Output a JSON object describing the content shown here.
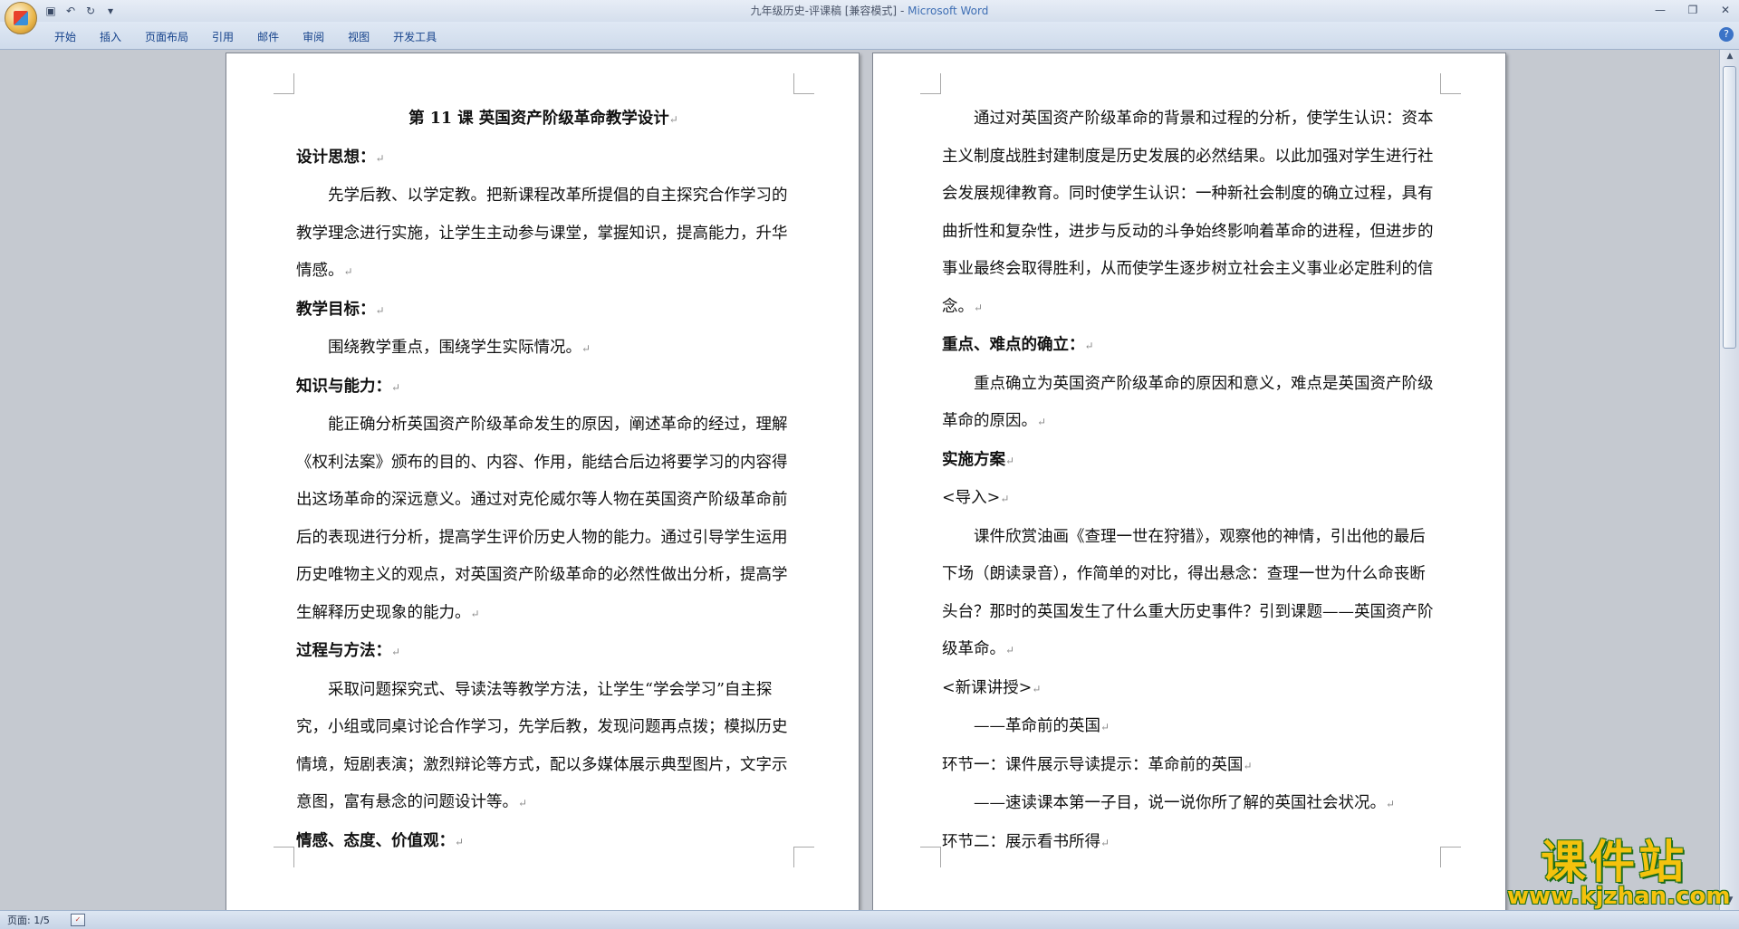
{
  "window": {
    "title_doc": "九年级历史-评课稿 [兼容模式]",
    "title_sep": " - ",
    "title_app": "Microsoft Word"
  },
  "ribbon": {
    "tabs": [
      "开始",
      "插入",
      "页面布局",
      "引用",
      "邮件",
      "审阅",
      "视图",
      "开发工具"
    ]
  },
  "status": {
    "page": "页面: 1/5"
  },
  "doc": {
    "left": [
      {
        "t": "第 11 课  英国资产阶级革命教学设计",
        "s": "title"
      },
      {
        "t": "设计思想：",
        "s": "h"
      },
      {
        "t": "先学后教、以学定教。把新课程改革所提倡的自主探究合作学习的教学理念进行实施，让学生主动参与课堂，掌握知识，提高能力，升华情感。",
        "s": "indent"
      },
      {
        "t": "教学目标：",
        "s": "h"
      },
      {
        "t": "围绕教学重点，围绕学生实际情况。",
        "s": "indent"
      },
      {
        "t": "知识与能力：",
        "s": "h"
      },
      {
        "t": "能正确分析英国资产阶级革命发生的原因，阐述革命的经过，理解《权利法案》颁布的目的、内容、作用，能结合后边将要学习的内容得出这场革命的深远意义。通过对克伦威尔等人物在英国资产阶级革命前后的表现进行分析，提高学生评价历史人物的能力。通过引导学生运用历史唯物主义的观点，对英国资产阶级革命的必然性做出分析，提高学生解释历史现象的能力。",
        "s": "indent"
      },
      {
        "t": "过程与方法：",
        "s": "h"
      },
      {
        "t": "采取问题探究式、导读法等教学方法，让学生“学会学习”自主探究，小组或同桌讨论合作学习，先学后教，发现问题再点拨；模拟历史情境，短剧表演；激烈辩论等方式，配以多媒体展示典型图片，文字示意图，富有悬念的问题设计等。",
        "s": "indent"
      },
      {
        "t": "情感、态度、价值观：",
        "s": "h"
      }
    ],
    "right": [
      {
        "t": "通过对英国资产阶级革命的背景和过程的分析，使学生认识：资本主义制度战胜封建制度是历史发展的必然结果。以此加强对学生进行社会发展规律教育。同时使学生认识：一种新社会制度的确立过程，具有曲折性和复杂性，进步与反动的斗争始终影响着革命的进程，但进步的事业最终会取得胜利，从而使学生逐步树立社会主义事业必定胜利的信念。",
        "s": "indent"
      },
      {
        "t": "重点、难点的确立：",
        "s": "h"
      },
      {
        "t": "重点确立为英国资产阶级革命的原因和意义，难点是英国资产阶级革命的原因。",
        "s": "indent"
      },
      {
        "t": "实施方案",
        "s": "h"
      },
      {
        "t": "<导入>",
        "s": ""
      },
      {
        "t": " 课件欣赏油画《查理一世在狩猎》，观察他的神情，引出他的最后下场（朗读录音），作简单的对比，得出悬念：查理一世为什么命丧断头台？那时的英国发生了什么重大历史事件？引到课题——英国资产阶级革命。",
        "s": "indent"
      },
      {
        "t": "<新课讲授>",
        "s": ""
      },
      {
        "t": "——革命前的英国",
        "s": "indent"
      },
      {
        "t": "环节一：课件展示导读提示：革命前的英国",
        "s": ""
      },
      {
        "t": "——速读课本第一子目，说一说你所了解的英国社会状况。",
        "s": "indent"
      },
      {
        "t": "环节二：展示看书所得",
        "s": ""
      }
    ]
  },
  "watermark": {
    "cn": "课件站",
    "url": "www.kjzhan.com"
  }
}
